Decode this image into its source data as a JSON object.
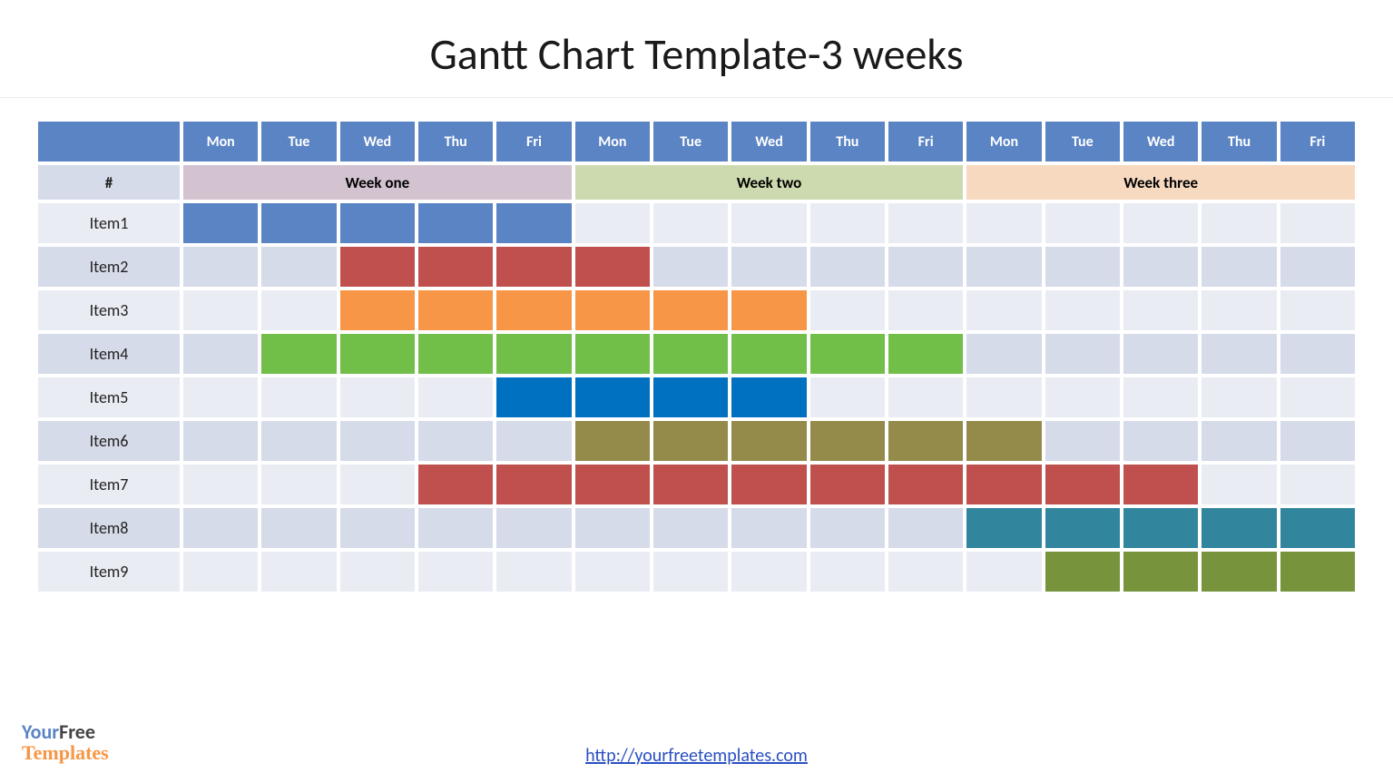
{
  "title": "Gantt Chart Template-3 weeks",
  "footer_link_text": "http://yourfreetemplates.com",
  "logo": {
    "line1a": "Your",
    "line1b": "Free",
    "line2": "Templates"
  },
  "header": {
    "days": [
      "Mon",
      "Tue",
      "Wed",
      "Thu",
      "Fri",
      "Mon",
      "Tue",
      "Wed",
      "Thu",
      "Fri",
      "Mon",
      "Tue",
      "Wed",
      "Thu",
      "Fri"
    ]
  },
  "weeks": {
    "hash": "#",
    "labels": [
      "Week one",
      "Week two",
      "Week three"
    ]
  },
  "rows": [
    {
      "label": "Item1",
      "start": 1,
      "end": 5,
      "color": "c-blue"
    },
    {
      "label": "Item2",
      "start": 3,
      "end": 6,
      "color": "c-red"
    },
    {
      "label": "Item3",
      "start": 3,
      "end": 8,
      "color": "c-orange"
    },
    {
      "label": "Item4",
      "start": 2,
      "end": 10,
      "color": "c-green"
    },
    {
      "label": "Item5",
      "start": 5,
      "end": 8,
      "color": "c-dblue"
    },
    {
      "label": "Item6",
      "start": 6,
      "end": 11,
      "color": "c-olive"
    },
    {
      "label": "Item7",
      "start": 4,
      "end": 13,
      "color": "c-dred"
    },
    {
      "label": "Item8",
      "start": 11,
      "end": 15,
      "color": "c-teal"
    },
    {
      "label": "Item9",
      "start": 12,
      "end": 15,
      "color": "c-dgreen"
    }
  ],
  "chart_data": {
    "type": "bar",
    "title": "Gantt Chart Template-3 weeks",
    "xlabel": "",
    "ylabel": "",
    "categories": [
      "W1 Mon",
      "W1 Tue",
      "W1 Wed",
      "W1 Thu",
      "W1 Fri",
      "W2 Mon",
      "W2 Tue",
      "W2 Wed",
      "W2 Thu",
      "W2 Fri",
      "W3 Mon",
      "W3 Tue",
      "W3 Wed",
      "W3 Thu",
      "W3 Fri"
    ],
    "series": [
      {
        "name": "Item1",
        "start_day": 1,
        "end_day": 5
      },
      {
        "name": "Item2",
        "start_day": 3,
        "end_day": 6
      },
      {
        "name": "Item3",
        "start_day": 3,
        "end_day": 8
      },
      {
        "name": "Item4",
        "start_day": 2,
        "end_day": 10
      },
      {
        "name": "Item5",
        "start_day": 5,
        "end_day": 8
      },
      {
        "name": "Item6",
        "start_day": 6,
        "end_day": 11
      },
      {
        "name": "Item7",
        "start_day": 4,
        "end_day": 13
      },
      {
        "name": "Item8",
        "start_day": 11,
        "end_day": 15
      },
      {
        "name": "Item9",
        "start_day": 12,
        "end_day": 15
      }
    ],
    "week_groups": [
      {
        "label": "Week one",
        "days": [
          1,
          2,
          3,
          4,
          5
        ]
      },
      {
        "label": "Week two",
        "days": [
          6,
          7,
          8,
          9,
          10
        ]
      },
      {
        "label": "Week three",
        "days": [
          11,
          12,
          13,
          14,
          15
        ]
      }
    ],
    "xlim": [
      1,
      15
    ]
  }
}
